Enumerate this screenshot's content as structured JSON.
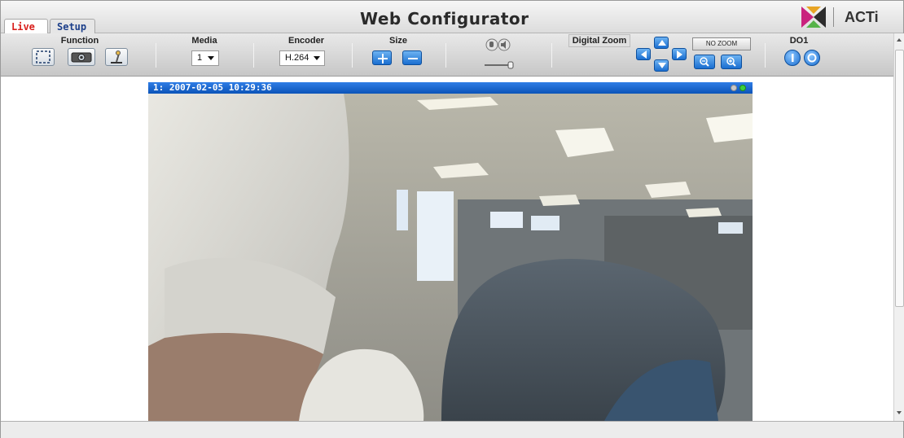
{
  "header": {
    "tabs": [
      {
        "label": "Live",
        "active": true
      },
      {
        "label": "Setup",
        "active": false
      }
    ],
    "title": "Web Configurator",
    "brand": "ACTi"
  },
  "toolbar": {
    "function": {
      "label": "Function",
      "buttons": [
        "fullscreen-icon",
        "snapshot-camera-icon",
        "record-icon"
      ]
    },
    "media": {
      "label": "Media",
      "value": "1"
    },
    "encoder": {
      "label": "Encoder",
      "value": "H.264"
    },
    "size": {
      "label": "Size",
      "buttons": [
        "zoom-in-plus-icon",
        "zoom-out-minus-icon"
      ]
    },
    "audio": {
      "buttons": [
        "microphone-icon",
        "speaker-icon"
      ],
      "volume_level": 0.85
    },
    "digital_zoom": {
      "label": "Digital Zoom",
      "no_zoom_label": "NO ZOOM",
      "buttons": [
        "pan-up-icon",
        "pan-left-icon",
        "pan-right-icon",
        "pan-down-icon",
        "zoom-out-icon",
        "zoom-in-icon"
      ]
    },
    "do1": {
      "label": "DO1",
      "buttons": [
        "do-on-icon",
        "do-off-icon"
      ]
    }
  },
  "video": {
    "channel": "1:",
    "timestamp": "2007-02-05 10:29:36"
  },
  "colors": {
    "live_tab": "#d9201c",
    "setup_tab": "#1c3f8a",
    "video_bar": "#0b53b8",
    "button_blue": "#1a6ed0"
  }
}
